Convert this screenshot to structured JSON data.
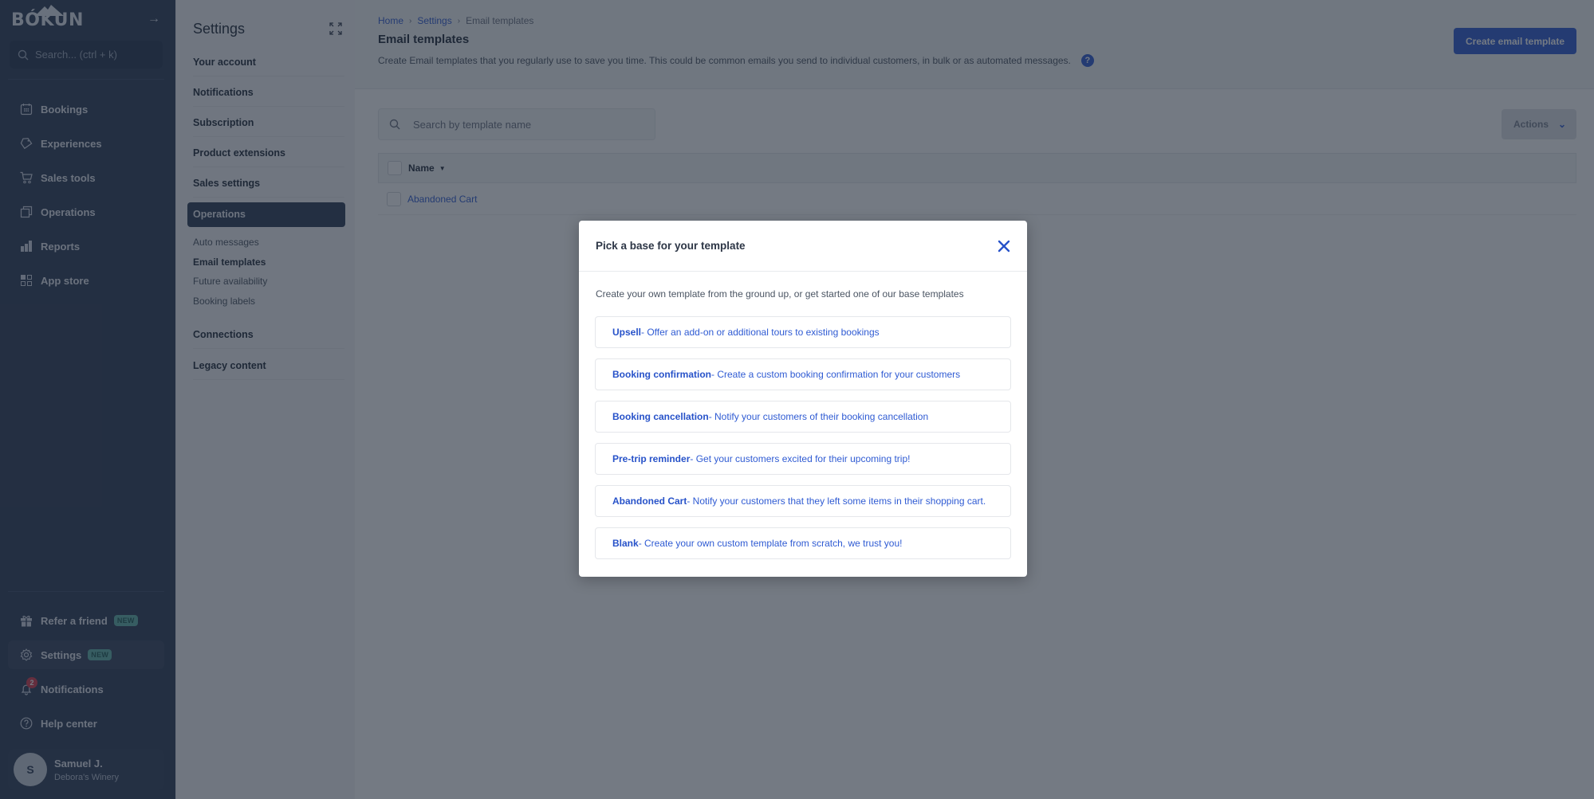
{
  "nav": {
    "logo_text": "BÓKUN",
    "search_placeholder": "Search... (ctrl + k)",
    "items": [
      {
        "label": "Bookings",
        "icon": "calendar-icon"
      },
      {
        "label": "Experiences",
        "icon": "tag-icon"
      },
      {
        "label": "Sales tools",
        "icon": "cart-icon"
      },
      {
        "label": "Operations",
        "icon": "copy-icon"
      },
      {
        "label": "Reports",
        "icon": "bar-chart-icon"
      },
      {
        "label": "App store",
        "icon": "apps-grid-icon"
      }
    ],
    "bottom_items": [
      {
        "label": "Refer a friend",
        "icon": "gift-icon",
        "badge": "NEW"
      },
      {
        "label": "Settings",
        "icon": "gear-icon",
        "badge": "NEW",
        "active": true
      },
      {
        "label": "Notifications",
        "icon": "bell-icon",
        "count": "2"
      },
      {
        "label": "Help center",
        "icon": "question-circle-icon"
      }
    ],
    "user": {
      "initial": "S",
      "name": "Samuel J.",
      "org": "Debora's Winery"
    }
  },
  "settings": {
    "title": "Settings",
    "sections": [
      {
        "label": "Your account"
      },
      {
        "label": "Notifications"
      },
      {
        "label": "Subscription"
      },
      {
        "label": "Product extensions"
      },
      {
        "label": "Sales settings"
      },
      {
        "label": "Operations",
        "active": true
      }
    ],
    "subitems": [
      {
        "label": "Auto messages"
      },
      {
        "label": "Email templates",
        "current": true
      },
      {
        "label": "Future availability"
      },
      {
        "label": "Booking labels"
      }
    ],
    "sections_after": [
      {
        "label": "Connections"
      },
      {
        "label": "Legacy content"
      }
    ]
  },
  "main": {
    "breadcrumb": [
      "Home",
      "Settings",
      "Email templates"
    ],
    "title": "Email templates",
    "description": "Create Email templates that you regularly use to save you time. This could be common emails you send to individual customers, in bulk or as automated messages.",
    "create_button": "Create email template",
    "search_placeholder": "Search by template name",
    "actions_button": "Actions",
    "table": {
      "columns": [
        "Name"
      ],
      "rows": [
        {
          "name": "Abandoned Cart"
        }
      ]
    }
  },
  "modal": {
    "title": "Pick a base for your template",
    "intro": "Create your own template from the ground up, or get started one of our base templates",
    "options": [
      {
        "name": "Upsell",
        "desc": " - Offer an add-on or additional tours to existing bookings"
      },
      {
        "name": "Booking confirmation",
        "desc": " - Create a custom booking confirmation for your customers"
      },
      {
        "name": "Booking cancellation",
        "desc": " - Notify your customers of their booking cancellation"
      },
      {
        "name": "Pre-trip reminder",
        "desc": " - Get your customers excited for their upcoming trip!"
      },
      {
        "name": "Abandoned Cart",
        "desc": " - Notify your customers that they left some items in their shopping cart."
      },
      {
        "name": "Blank",
        "desc": " - Create your own custom template from scratch, we trust you!"
      }
    ]
  },
  "colors": {
    "nav_bg": "#2b3a55",
    "accent": "#2f5bd3",
    "badge_new": "#5fb3a8",
    "notif_badge": "#d6384a"
  }
}
